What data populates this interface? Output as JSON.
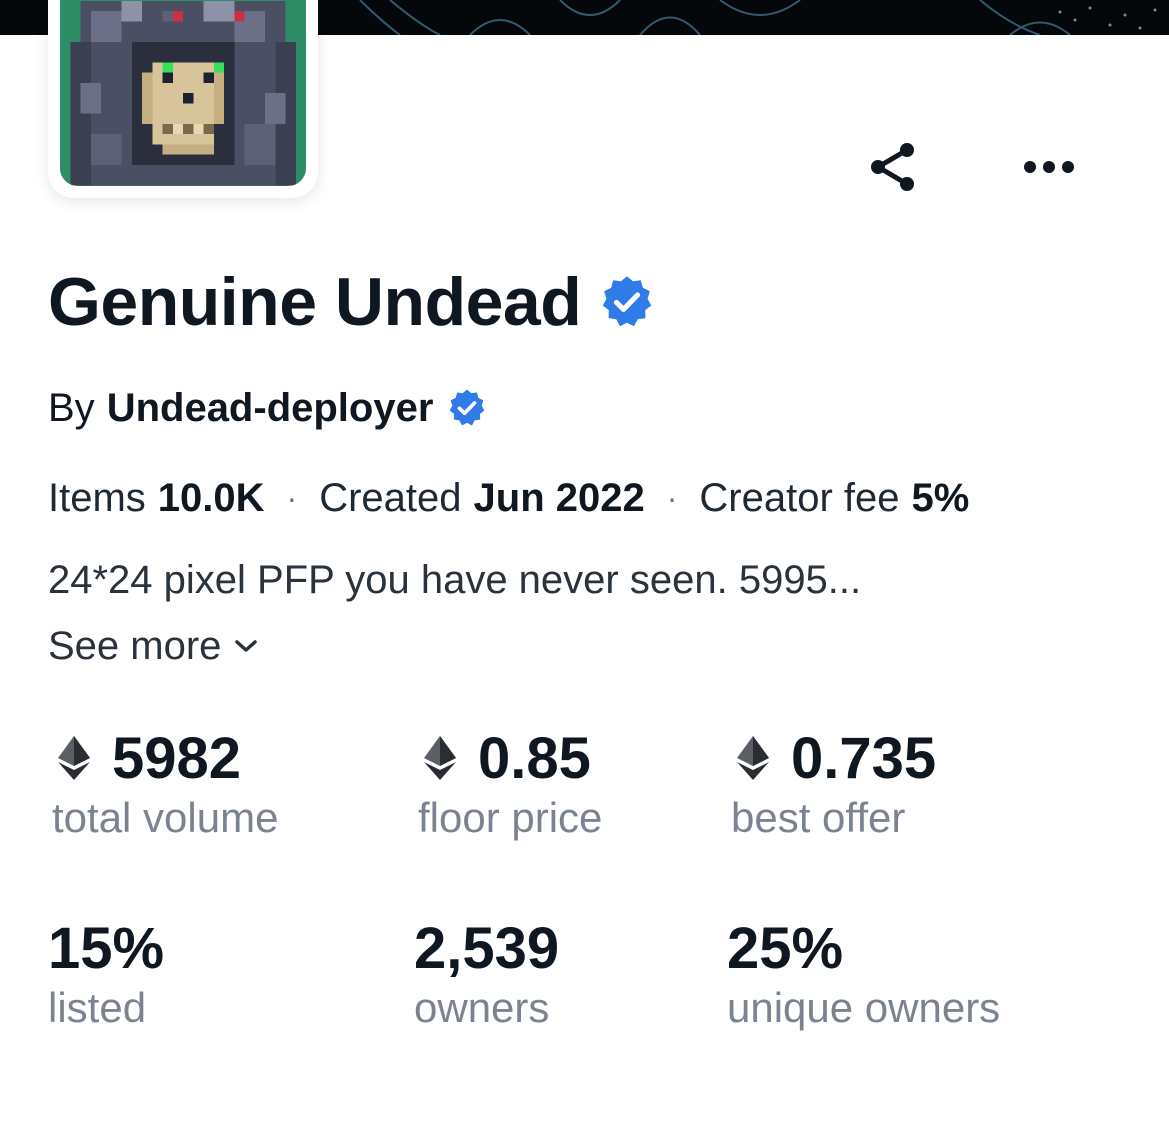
{
  "collection": {
    "name": "Genuine Undead",
    "verified_icon": "verified-badge-icon",
    "by_label": "By",
    "creator": "Undead-deployer",
    "meta": {
      "items_label": "Items",
      "items_value": "10.0K",
      "created_label": "Created",
      "created_value": "Jun 2022",
      "fee_label": "Creator fee",
      "fee_value": "5%",
      "separator": "·"
    },
    "description": "24*24 pixel PFP you have never seen. 5995...",
    "see_more": "See more"
  },
  "actions": {
    "share_icon": "share-icon",
    "more_icon": "more-icon"
  },
  "stats": [
    {
      "value": "5982",
      "label": "total volume",
      "currency_icon": "eth-icon"
    },
    {
      "value": "0.85",
      "label": "floor price",
      "currency_icon": "eth-icon"
    },
    {
      "value": "0.735",
      "label": "best offer",
      "currency_icon": "eth-icon"
    },
    {
      "value": "15%",
      "label": "listed"
    },
    {
      "value": "2,539",
      "label": "owners"
    },
    {
      "value": "25%",
      "label": "unique owners"
    }
  ],
  "colors": {
    "verified": "#2f7be8",
    "text": "#0f1720",
    "muted": "#7b8390",
    "avatar_bg": "#2e8c66"
  }
}
